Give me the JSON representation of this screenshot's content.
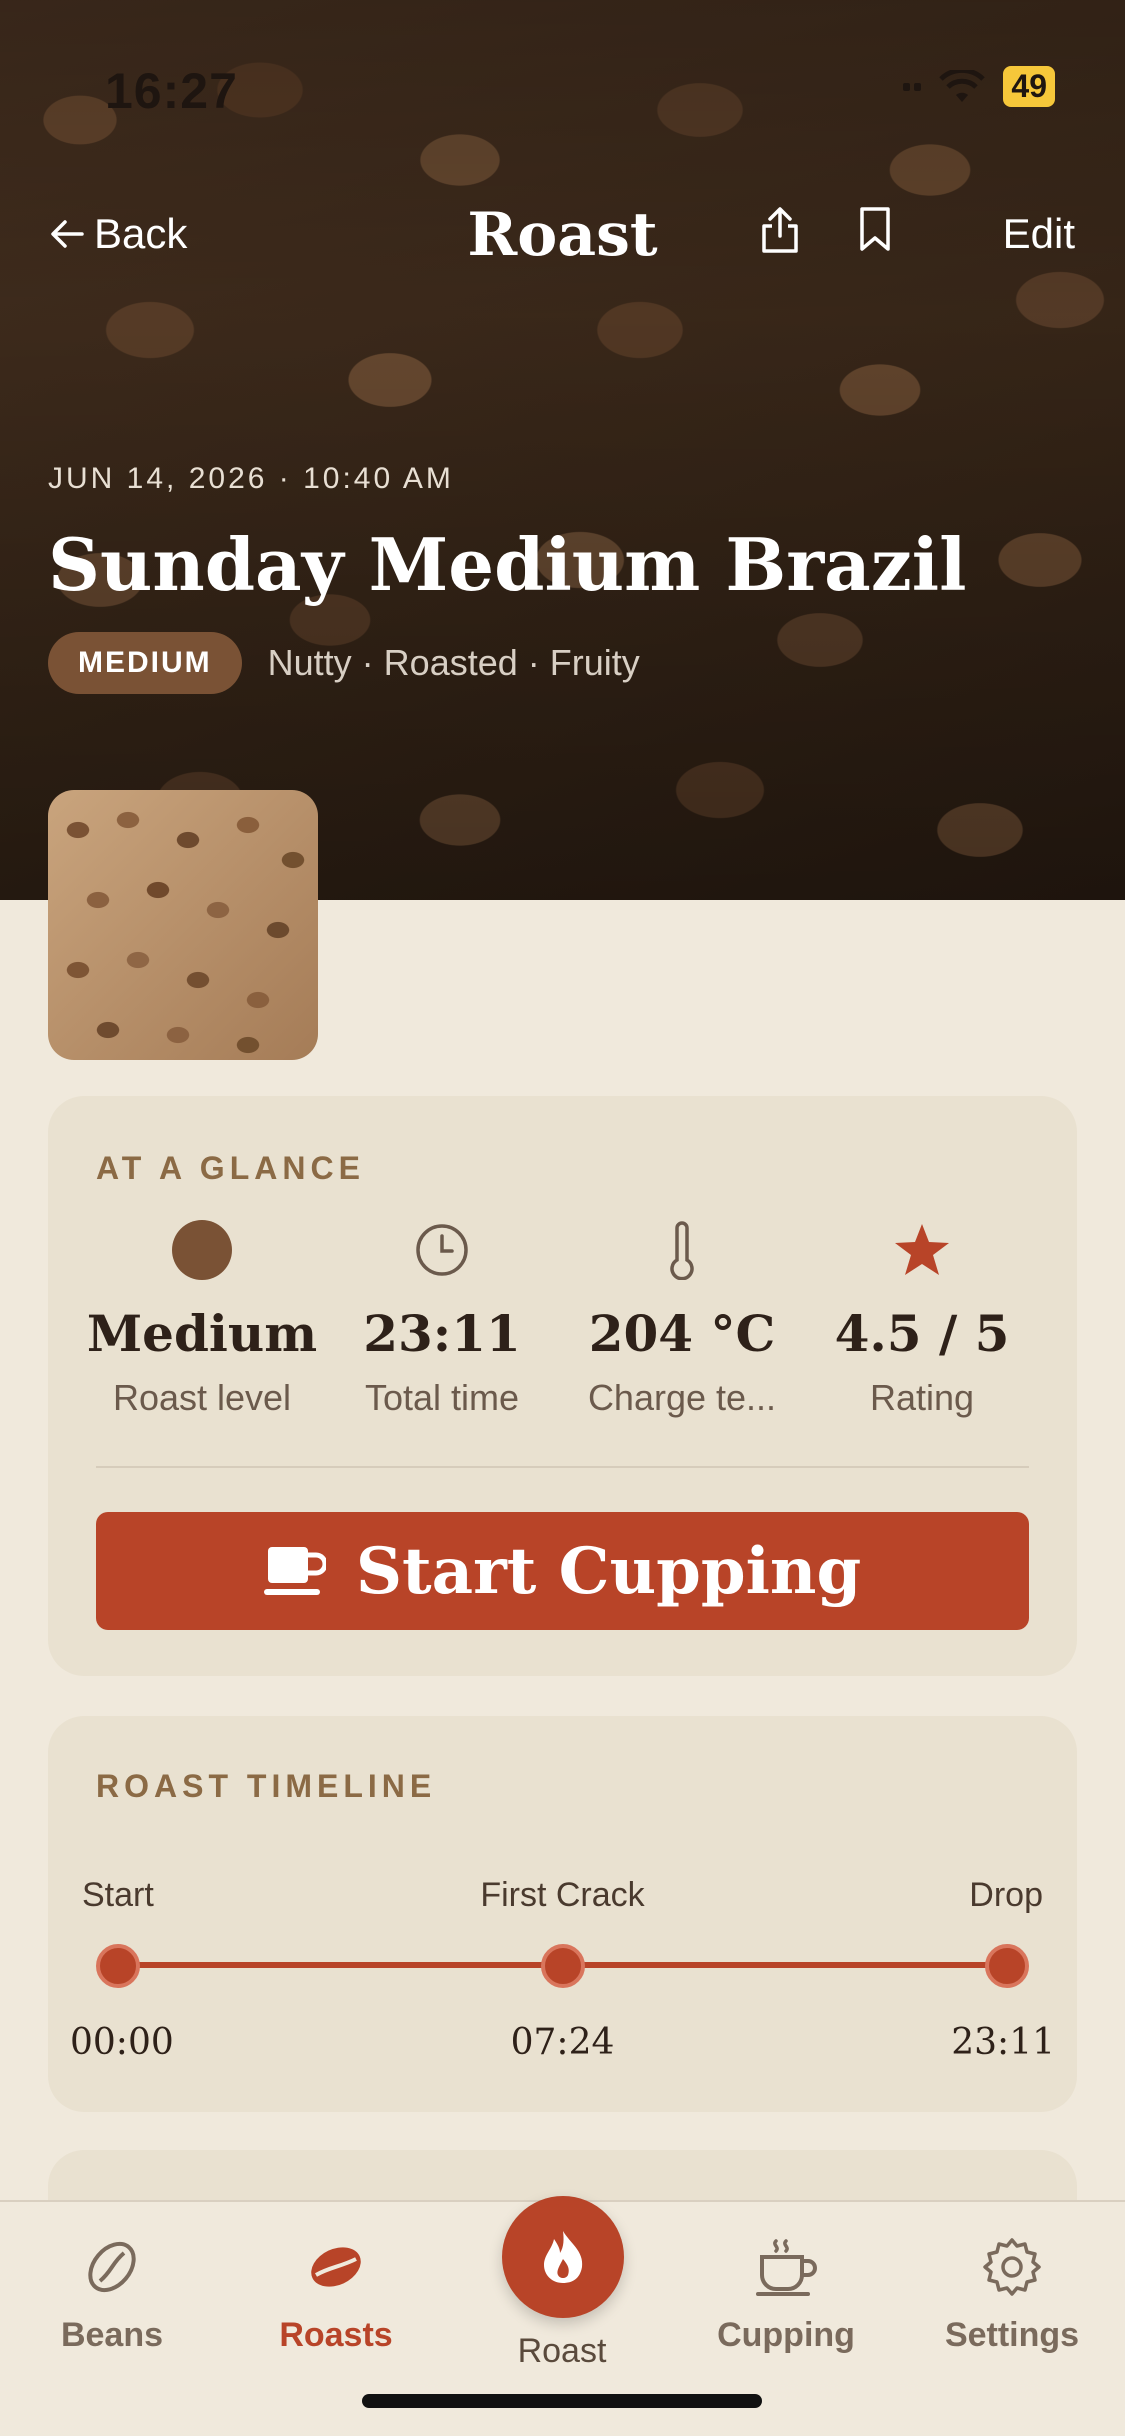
{
  "status": {
    "time": "16:27",
    "battery": "49"
  },
  "nav": {
    "back_label": "Back",
    "title": "Roast",
    "edit_label": "Edit"
  },
  "hero": {
    "meta": "JUN 14, 2026 · 10:40 AM",
    "title": "Sunday Medium Brazil",
    "badge": "MEDIUM",
    "notes": "Nutty · Roasted · Fruity"
  },
  "glance": {
    "label": "AT A GLANCE",
    "stats": [
      {
        "icon": "roast-dot-icon",
        "value": "Medium",
        "label": "Roast level"
      },
      {
        "icon": "clock-icon",
        "value": "23:11",
        "label": "Total time"
      },
      {
        "icon": "thermometer-icon",
        "value": "204 °C",
        "label": "Charge te..."
      },
      {
        "icon": "star-icon",
        "value": "4.5 / 5",
        "label": "Rating"
      }
    ],
    "cta_label": "Start Cupping"
  },
  "timeline": {
    "label": "ROAST TIMELINE",
    "points": [
      {
        "name": "Start",
        "time": "00:00"
      },
      {
        "name": "First Crack",
        "time": "07:24"
      },
      {
        "name": "Drop",
        "time": "23:11"
      }
    ]
  },
  "tabs": [
    {
      "label": "Beans",
      "icon": "bean-icon",
      "active": false
    },
    {
      "label": "Roasts",
      "icon": "bean-filled-icon",
      "active": true
    },
    {
      "label": "Roast",
      "icon": "flame-icon",
      "active": false
    },
    {
      "label": "Cupping",
      "icon": "cup-icon",
      "active": false
    },
    {
      "label": "Settings",
      "icon": "gear-icon",
      "active": false
    }
  ],
  "colors": {
    "accent": "#b84428",
    "background": "#f0e9dc",
    "card": "#e9e1d0",
    "badge": "#7a5235"
  }
}
